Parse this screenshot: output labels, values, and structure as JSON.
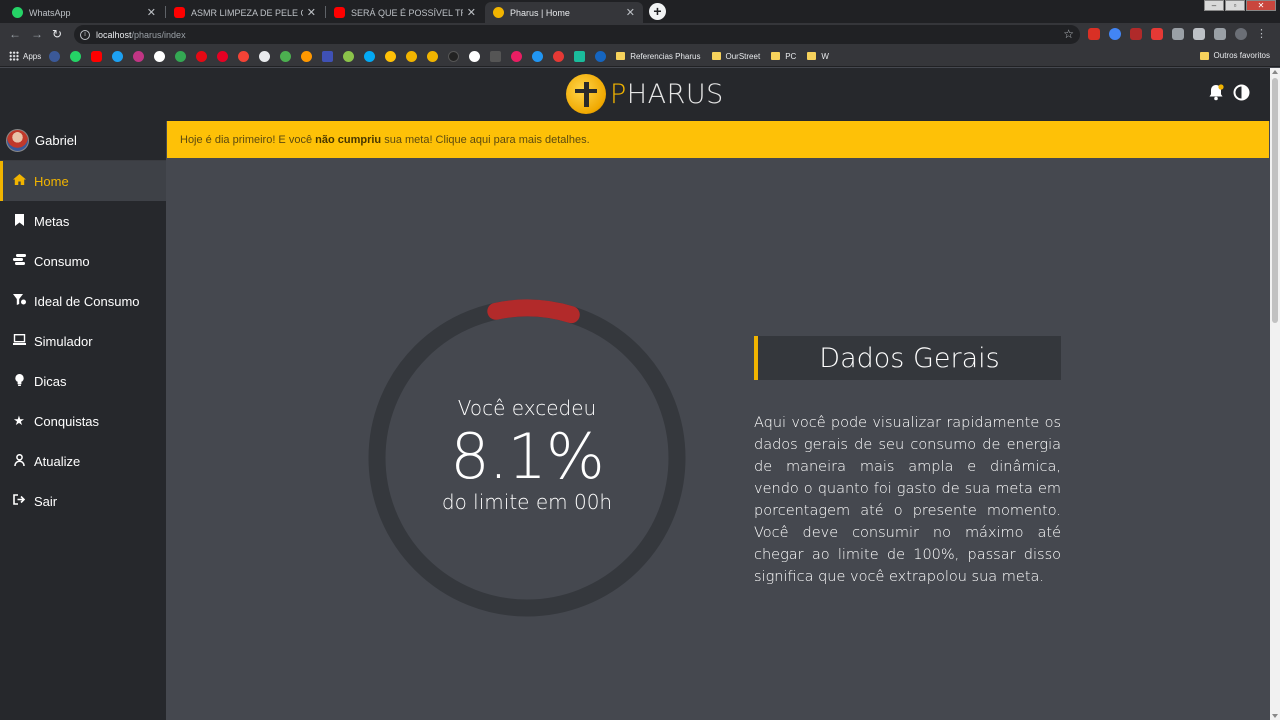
{
  "browser": {
    "tabs": [
      {
        "title": "WhatsApp",
        "icon": "whatsapp-icon",
        "color": "#25d366"
      },
      {
        "title": "ASMR LIMPEZA DE PELE COM VO",
        "icon": "youtube-icon",
        "color": "#ff0000"
      },
      {
        "title": "SERÁ QUE É POSSÍVEL TRANSFO",
        "icon": "youtube-icon",
        "color": "#ff0000"
      },
      {
        "title": "Pharus | Home",
        "icon": "pharus-icon",
        "color": "#f1b400"
      }
    ],
    "url_host": "localhost",
    "url_path": "/pharus/index",
    "bookmarks": {
      "apps_label": "Apps",
      "folders": [
        "Referencias Pharus",
        "OurStreet",
        "PC",
        "W"
      ],
      "other_label": "Outros favoritos"
    }
  },
  "app": {
    "brand_first_letter": "P",
    "brand_rest": "HARUS",
    "user_name": "Gabriel",
    "nav": [
      {
        "label": "Home",
        "icon": "home-icon",
        "active": true
      },
      {
        "label": "Metas",
        "icon": "bookmark-icon"
      },
      {
        "label": "Consumo",
        "icon": "coins-icon"
      },
      {
        "label": "Ideal de Consumo",
        "icon": "filter-icon"
      },
      {
        "label": "Simulador",
        "icon": "laptop-icon"
      },
      {
        "label": "Dicas",
        "icon": "lightbulb-icon"
      },
      {
        "label": "Conquistas",
        "icon": "star-icon"
      },
      {
        "label": "Atualize",
        "icon": "user-update-icon"
      },
      {
        "label": "Sair",
        "icon": "sign-out-icon"
      }
    ],
    "alert": {
      "prefix": "Hoje é dia primeiro! E você ",
      "bold": "não cumpriu",
      "suffix": " sua meta! Clique aqui para mais detalhes."
    },
    "gauge": {
      "top_label": "Você excedeu",
      "value_text": "8.1%",
      "value": 8.1,
      "bottom_label": "do limite em 00h",
      "track_color": "#35383d",
      "progress_color": "#b22a2a"
    },
    "card": {
      "title": "Dados Gerais",
      "text": "Aqui você pode visualizar rapidamente os dados gerais de seu consumo de energia de maneira mais ampla e dinâmica, vendo o quanto foi gasto de sua meta em porcentagem até o presente momento. Você deve consumir no máximo até chegar ao limite de 100%, passar disso significa que você extrapolou sua meta."
    },
    "colors": {
      "accent": "#f1b400",
      "alert_bg": "#fec107",
      "sidebar_bg": "#26282c",
      "main_bg": "#45484f"
    }
  }
}
